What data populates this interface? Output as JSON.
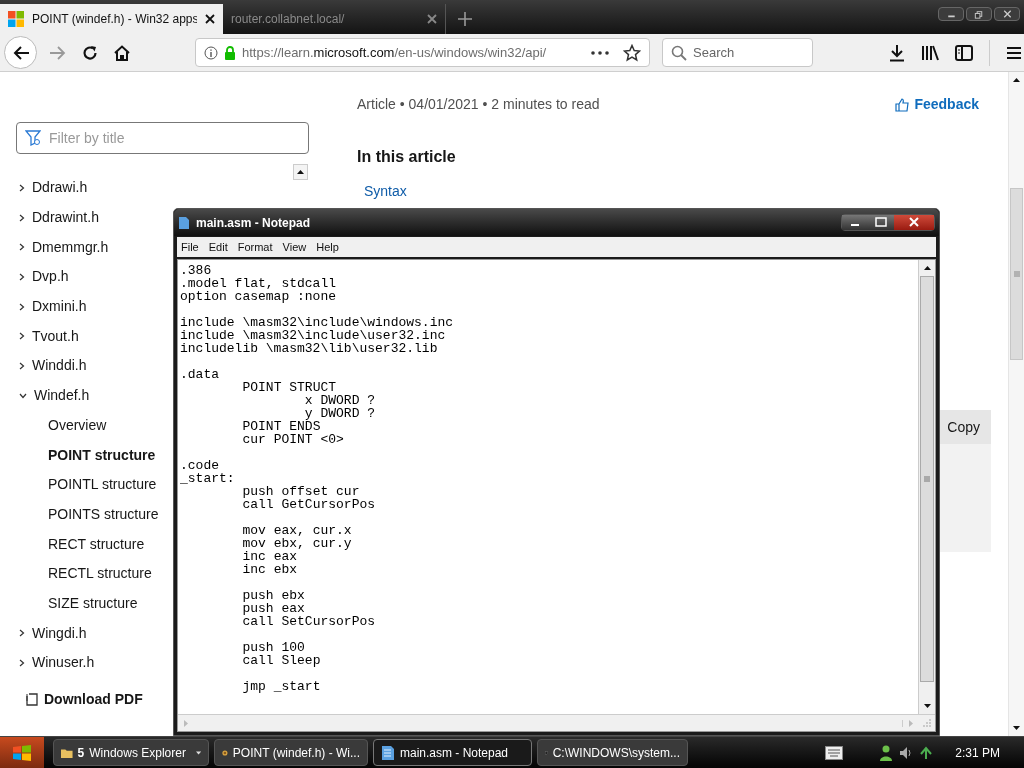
{
  "browser": {
    "tabs": [
      {
        "title": "POINT (windef.h) - Win32 apps",
        "selected": true
      },
      {
        "title": "router.collabnet.local/",
        "selected": false
      }
    ],
    "url": [
      "https://learn.",
      "microsoft.com",
      "/en-us/windows/win32/api/"
    ],
    "search": {
      "placeholder": "Search"
    }
  },
  "sidebar": {
    "filter": {
      "placeholder": "Filter by title"
    },
    "items": [
      {
        "label": "Ddrawi.h",
        "expanded": false
      },
      {
        "label": "Ddrawint.h",
        "expanded": false
      },
      {
        "label": "Dmemmgr.h",
        "expanded": false
      },
      {
        "label": "Dvp.h",
        "expanded": false
      },
      {
        "label": "Dxmini.h",
        "expanded": false
      },
      {
        "label": "Tvout.h",
        "expanded": false
      },
      {
        "label": "Winddi.h",
        "expanded": false
      },
      {
        "label": "Windef.h",
        "expanded": true,
        "children": [
          {
            "label": "Overview",
            "selected": false
          },
          {
            "label": "POINT structure",
            "selected": true
          },
          {
            "label": "POINTL structure",
            "selected": false
          },
          {
            "label": "POINTS structure",
            "selected": false
          },
          {
            "label": "RECT structure",
            "selected": false
          },
          {
            "label": "RECTL structure",
            "selected": false
          },
          {
            "label": "SIZE structure",
            "selected": false
          }
        ]
      },
      {
        "label": "Wingdi.h",
        "expanded": false
      },
      {
        "label": "Winuser.h",
        "expanded": false
      }
    ],
    "download": "Download PDF"
  },
  "article": {
    "meta": "Article • 04/01/2021 • 2 minutes to read",
    "feedback": "Feedback",
    "toc_heading": "In this article",
    "toc": [
      "Syntax"
    ],
    "copy_button": "Copy"
  },
  "notepad": {
    "title": "main.asm - Notepad",
    "menu": [
      "File",
      "Edit",
      "Format",
      "View",
      "Help"
    ],
    "text": ".386\n.model flat, stdcall\noption casemap :none\n\ninclude \\masm32\\include\\windows.inc\ninclude \\masm32\\include\\user32.inc\nincludelib \\masm32\\lib\\user32.lib\n\n.data\n\tPOINT STRUCT\n\t\tx DWORD ?\n\t\ty DWORD ?\n\tPOINT ENDS\n\tcur POINT <0>\n\n.code\n_start:\n\tpush offset cur\n\tcall GetCursorPos\n\n\tmov eax, cur.x\n\tmov ebx, cur.y\n\tinc eax\n\tinc ebx\n\n\tpush ebx\n\tpush eax\n\tcall SetCursorPos\n\n\tpush 100\n\tcall Sleep\n\n\tjmp _start"
  },
  "taskbar": {
    "items": [
      {
        "count": "5",
        "label": "Windows Explorer",
        "selected": false
      },
      {
        "label": "POINT (windef.h) - Wi...",
        "selected": false
      },
      {
        "label": "main.asm - Notepad",
        "selected": true
      },
      {
        "label": "C:\\WINDOWS\\system...",
        "selected": false
      }
    ],
    "clock": "2:31 PM"
  }
}
